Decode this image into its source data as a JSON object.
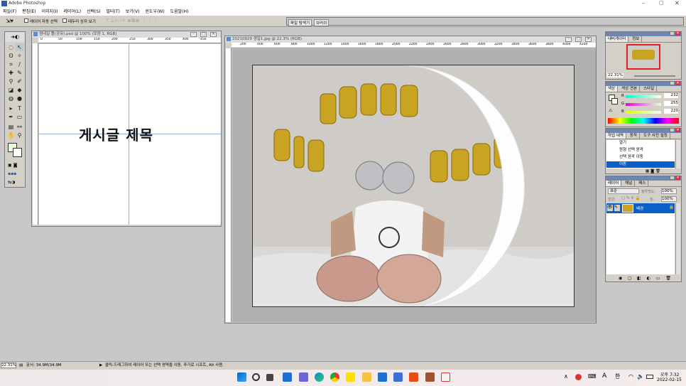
{
  "app": {
    "title": "Adobe Photoshop"
  },
  "menu": [
    "파일(F)",
    "편집(E)",
    "이미지(I)",
    "레이어(L)",
    "선택(S)",
    "필터(T)",
    "보기(V)",
    "윈도우(W)",
    "도움말(H)"
  ],
  "options": {
    "auto_select": "레이어 자동 선택",
    "show_bounds": "테두리 상자 보기"
  },
  "docks": [
    "파일 탐색기",
    "브러쉬"
  ],
  "doc1": {
    "title": "썸네일 틀(공유).psd @ 100% (모양 1, RGB)",
    "text": "게시글 제목",
    "ruler": [
      "0",
      "50",
      "100",
      "150",
      "200",
      "250",
      "300",
      "350",
      "400",
      "450"
    ]
  },
  "doc2": {
    "title": "20210929 생일1.jpg @ 22.3% (RGB)",
    "ruler": [
      "200",
      "400",
      "600",
      "800",
      "1000",
      "1200",
      "1400",
      "1600",
      "1800",
      "2000",
      "2200",
      "2400",
      "2600",
      "2800",
      "3000",
      "3200",
      "3400",
      "3600",
      "3800",
      "4000",
      "4200"
    ]
  },
  "navigator": {
    "tabs": [
      "내비게이터",
      "정보"
    ],
    "zoom": "22.31%"
  },
  "color": {
    "tabs": [
      "색상",
      "색상 견본",
      "스타일"
    ],
    "r_label": "R",
    "g_label": "G",
    "b_label": "B",
    "r": "232",
    "g": "255",
    "b": "220",
    "fg": "#e8ffdc"
  },
  "history": {
    "tabs": [
      "작업 내역",
      "동작",
      "도구 사전 설정"
    ],
    "items": [
      "열기",
      "원형 선택 윤곽",
      "선택 윤곽 이동",
      "이동"
    ]
  },
  "layers": {
    "tabs": [
      "레이어",
      "채널",
      "패스"
    ],
    "blend": "표준",
    "opacity_label": "불투명도:",
    "opacity": "100%",
    "lock_label": "잠금:",
    "fill_label": "칠:",
    "fill": "100%",
    "layer_name": "배경"
  },
  "status": {
    "zoom": "22.31%",
    "doc": "문서: 34.9M/34.9M",
    "hint": "클릭-드래그하여 레이어 또는 선택 영역을 이동, 추가로 시프트, Alt 사용."
  },
  "taskbar": {
    "lang": "A",
    "ime": "한",
    "time": "오후 7:32",
    "date": "2022-02-15"
  }
}
